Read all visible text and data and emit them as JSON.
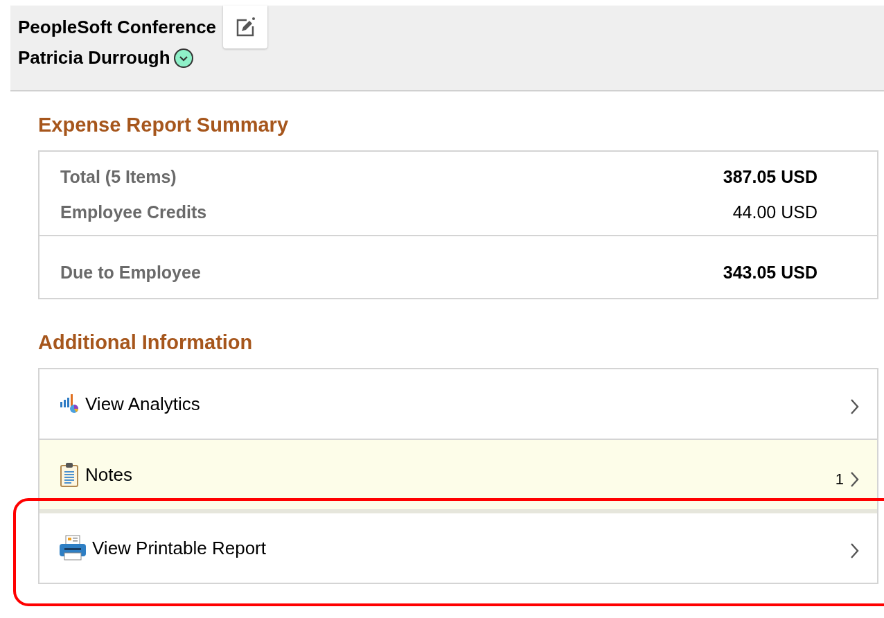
{
  "header": {
    "title": "PeopleSoft Conference",
    "employee": "Patricia Durrough"
  },
  "summary": {
    "title": "Expense Report Summary",
    "groups": [
      [
        {
          "label": "Total (5 Items)",
          "value": "387.05 USD",
          "bold": true
        },
        {
          "label": "Employee Credits",
          "value": "44.00 USD",
          "bold": false
        }
      ],
      [
        {
          "label": "Due to Employee",
          "value": "343.05 USD",
          "bold": true
        }
      ]
    ]
  },
  "additional": {
    "title": "Additional Information",
    "items": [
      {
        "kind": "analytics",
        "label": "View Analytics",
        "selected": false,
        "highlighted": false
      },
      {
        "kind": "notes",
        "label": "Notes",
        "count": "1",
        "selected": true,
        "highlighted": false
      },
      {
        "kind": "print",
        "label": "View Printable Report",
        "selected": false,
        "highlighted": true
      }
    ]
  }
}
